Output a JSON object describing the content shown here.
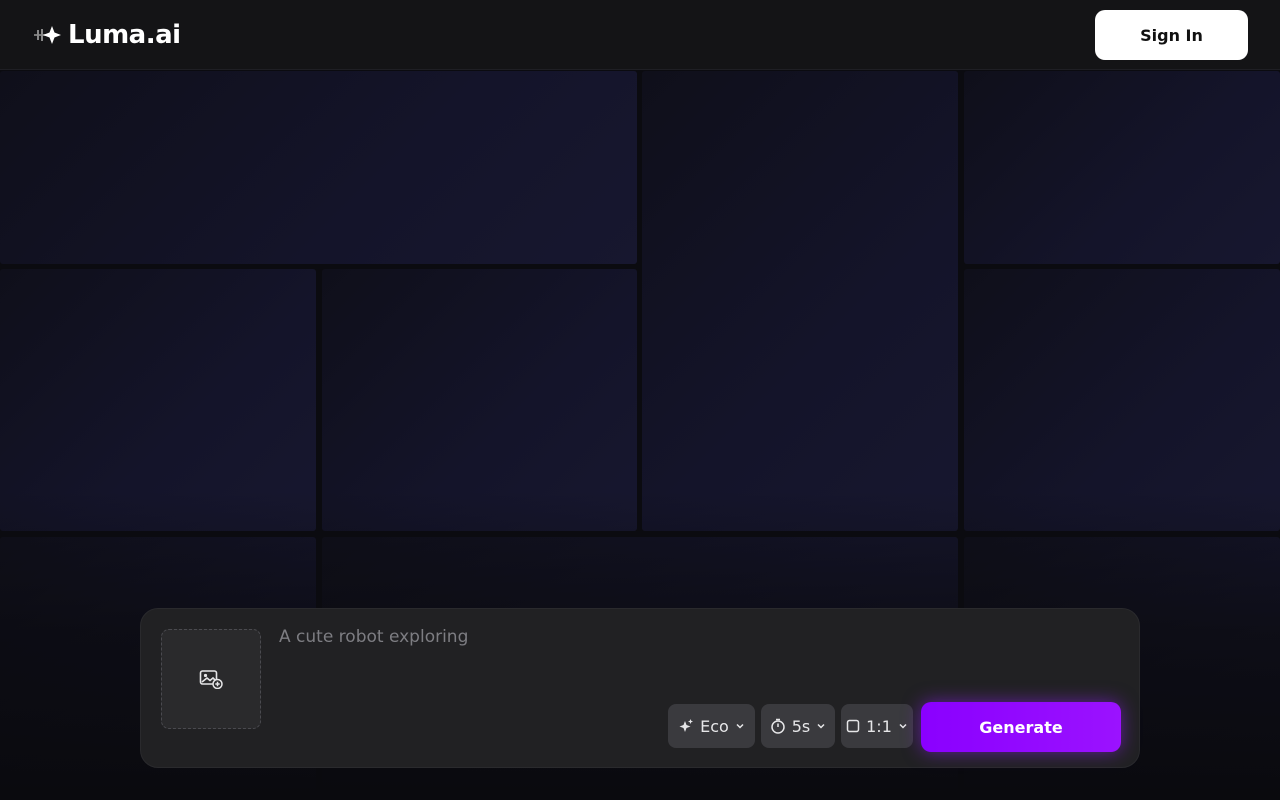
{
  "header": {
    "logo_text": "Luma.ai",
    "signin_label": "Sign In"
  },
  "prompt": {
    "placeholder": "A cute robot exploring",
    "value": ""
  },
  "options": {
    "model_label": "Eco",
    "duration_label": "5s",
    "aspect_label": "1:1"
  },
  "actions": {
    "generate_label": "Generate"
  },
  "colors": {
    "accent": "#8a00ff",
    "background": "#0b0b10",
    "panel": "#212123"
  },
  "icons": [
    "logo-mark-icon",
    "image-add-icon",
    "sparkle-icon",
    "timer-icon",
    "square-ratio-icon",
    "chevron-down-icon"
  ]
}
